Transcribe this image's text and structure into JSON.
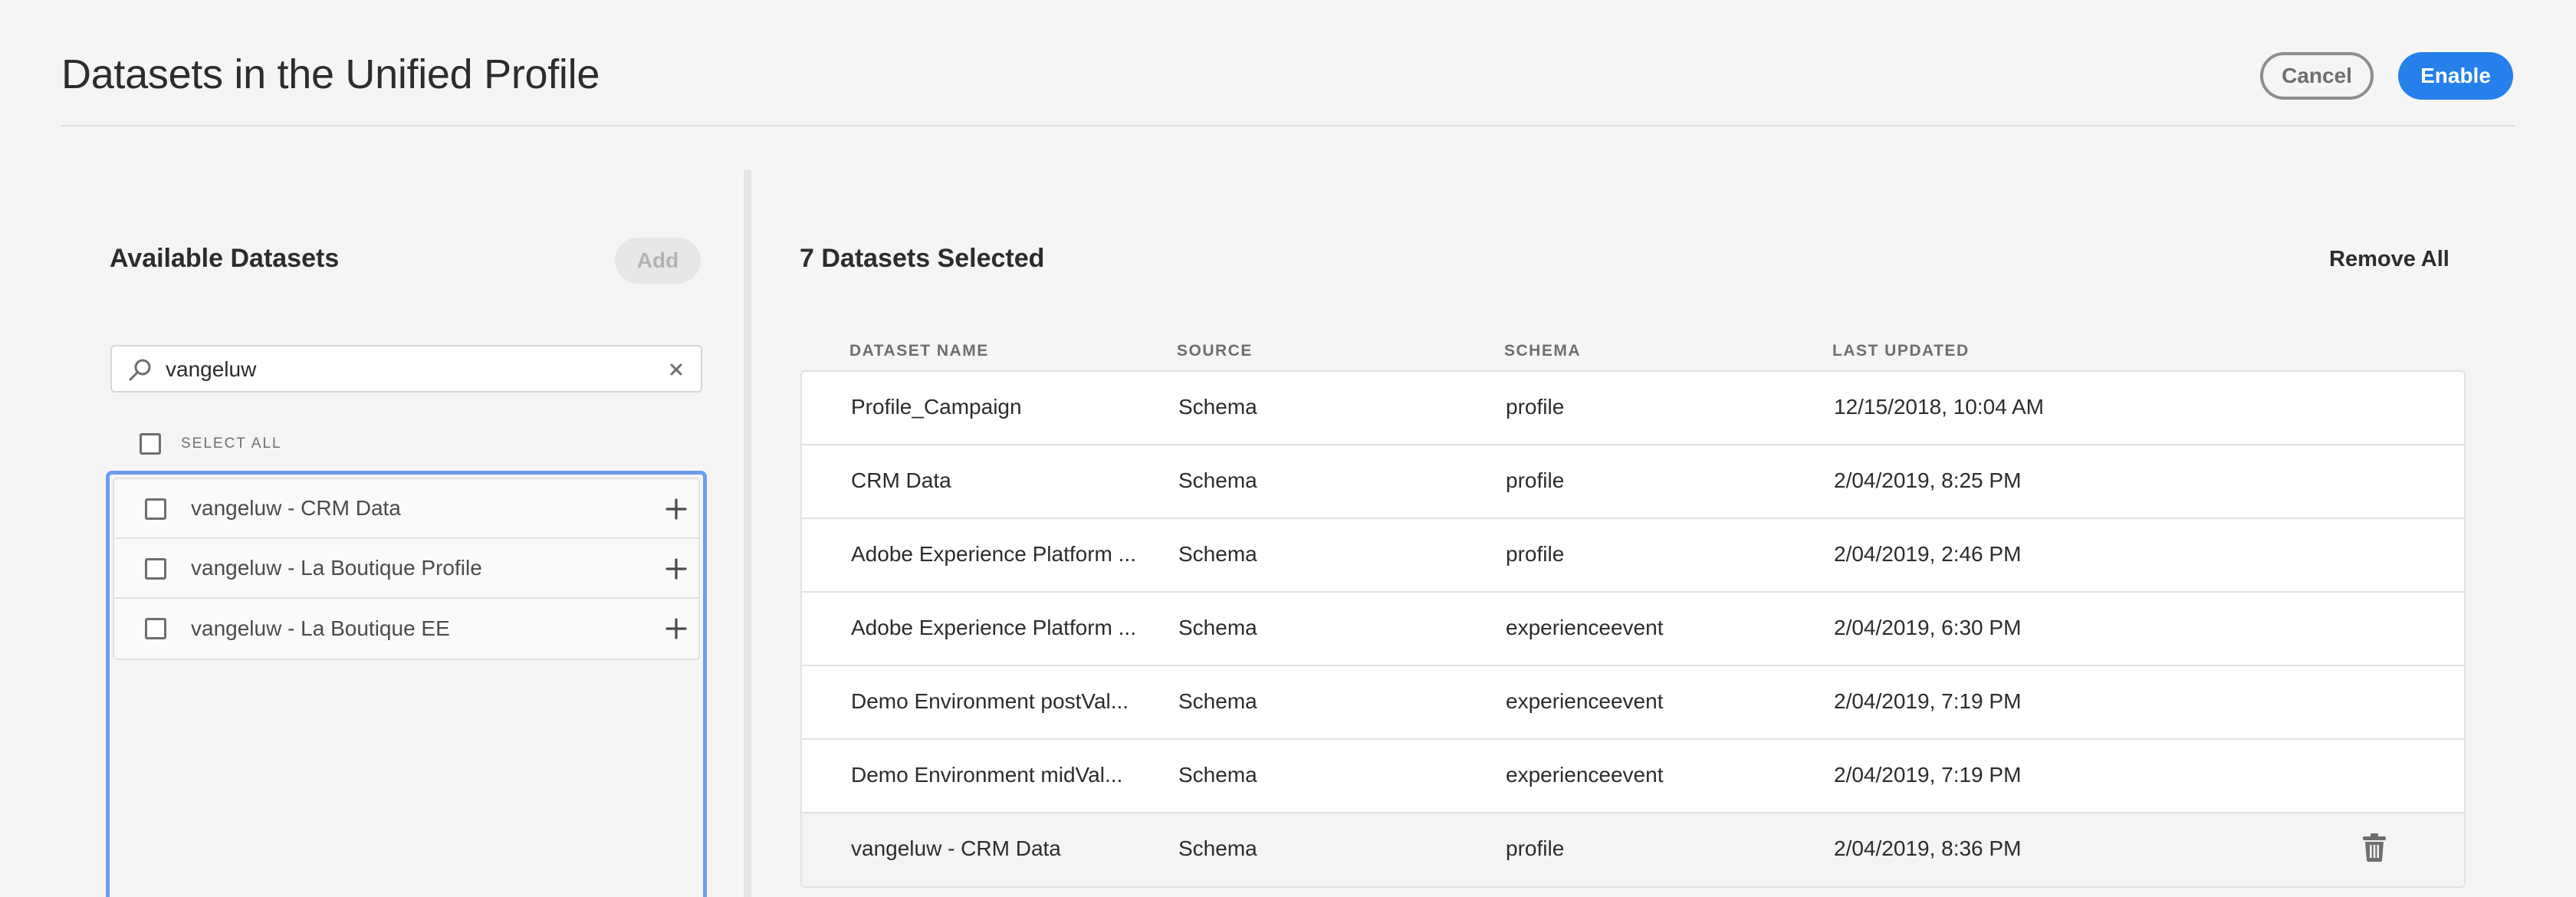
{
  "header": {
    "title": "Datasets in the Unified Profile",
    "cancel_label": "Cancel",
    "enable_label": "Enable"
  },
  "available": {
    "title": "Available Datasets",
    "add_label": "Add",
    "search_value": "vangeluw",
    "select_all_label": "SELECT ALL",
    "items": [
      {
        "label": "vangeluw - CRM Data"
      },
      {
        "label": "vangeluw - La Boutique Profile"
      },
      {
        "label": "vangeluw - La Boutique EE"
      }
    ]
  },
  "selected": {
    "title": "7 Datasets Selected",
    "remove_all_label": "Remove All",
    "columns": [
      "DATASET NAME",
      "SOURCE",
      "SCHEMA",
      "LAST UPDATED"
    ],
    "rows": [
      {
        "name": "Profile_Campaign",
        "source": "Schema",
        "schema": "profile",
        "updated": "12/15/2018, 10:04 AM"
      },
      {
        "name": "CRM Data",
        "source": "Schema",
        "schema": "profile",
        "updated": "2/04/2019, 8:25 PM"
      },
      {
        "name": "Adobe Experience Platform ...",
        "source": "Schema",
        "schema": "profile",
        "updated": "2/04/2019, 2:46 PM"
      },
      {
        "name": "Adobe Experience Platform ...",
        "source": "Schema",
        "schema": "experienceevent",
        "updated": "2/04/2019, 6:30 PM"
      },
      {
        "name": "Demo Environment postVal...",
        "source": "Schema",
        "schema": "experienceevent",
        "updated": "2/04/2019, 7:19 PM"
      },
      {
        "name": "Demo Environment midVal...",
        "source": "Schema",
        "schema": "experienceevent",
        "updated": "2/04/2019, 7:19 PM"
      },
      {
        "name": "vangeluw - CRM Data",
        "source": "Schema",
        "schema": "profile",
        "updated": "2/04/2019, 8:36 PM"
      }
    ]
  },
  "colors": {
    "accent": "#2680eb",
    "drop_zone_border": "#6d9cf0",
    "background": "#f5f5f5"
  },
  "icons": {
    "search": "search-icon",
    "clear": "close-icon",
    "add_item": "plus-icon",
    "delete": "trash-icon"
  }
}
